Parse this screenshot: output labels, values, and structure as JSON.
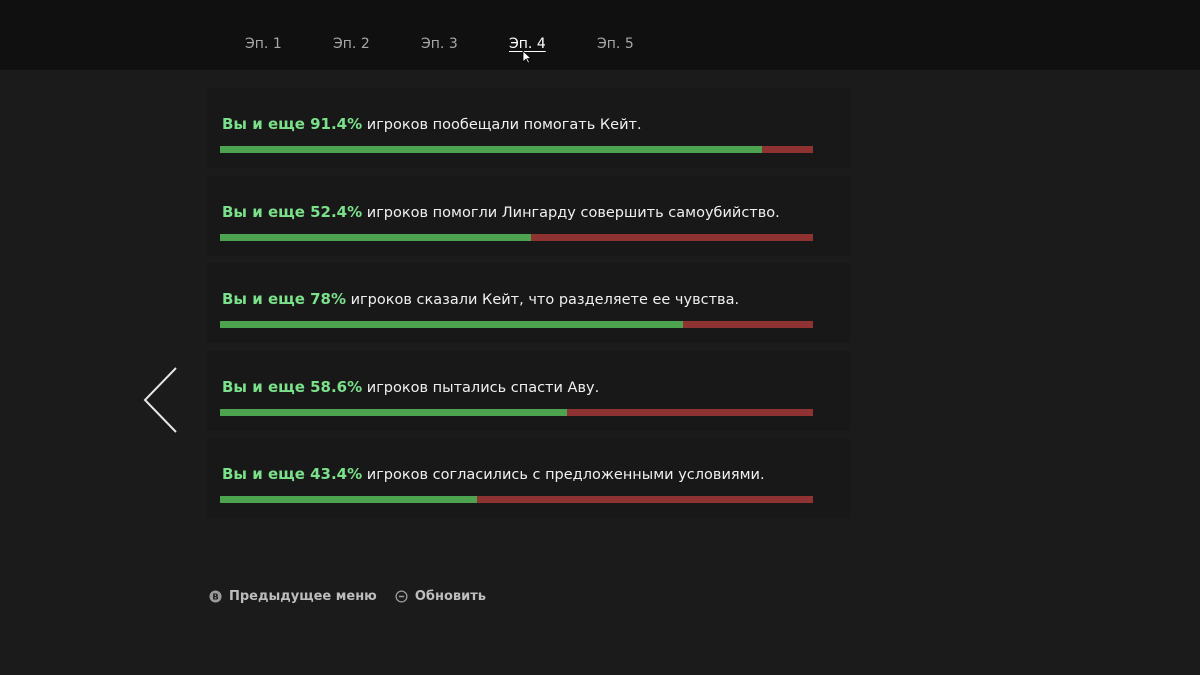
{
  "tabs": [
    {
      "label": "Эп. 1",
      "active": false
    },
    {
      "label": "Эп. 2",
      "active": false
    },
    {
      "label": "Эп. 3",
      "active": false
    },
    {
      "label": "Эп. 4",
      "active": true
    },
    {
      "label": "Эп. 5",
      "active": false
    }
  ],
  "stats": [
    {
      "lead": "Вы и еще 91.4%",
      "text": " игроков пообещали помогать Кейт.",
      "percent": 91.4
    },
    {
      "lead": "Вы и еще 52.4%",
      "text": " игроков помогли Лингарду совершить самоубийство.",
      "percent": 52.4
    },
    {
      "lead": "Вы и еще 78%",
      "text": " игроков сказали Кейт, что разделяете ее чувства.",
      "percent": 78
    },
    {
      "lead": "Вы и еще 58.6%",
      "text": " игроков пытались спасти Аву.",
      "percent": 58.6
    },
    {
      "lead": "Вы и еще 43.4%",
      "text": " игроков согласились с предложенными условиями.",
      "percent": 43.4
    }
  ],
  "bottom_nav": {
    "back_label": "Предыдущее меню",
    "back_icon": "b-button-icon",
    "refresh_label": "Обновить",
    "refresh_icon": "minus-button-icon"
  },
  "colors": {
    "choice_green": "#4ea351",
    "other_red": "#8e3232",
    "lead_text": "#7be08a"
  }
}
